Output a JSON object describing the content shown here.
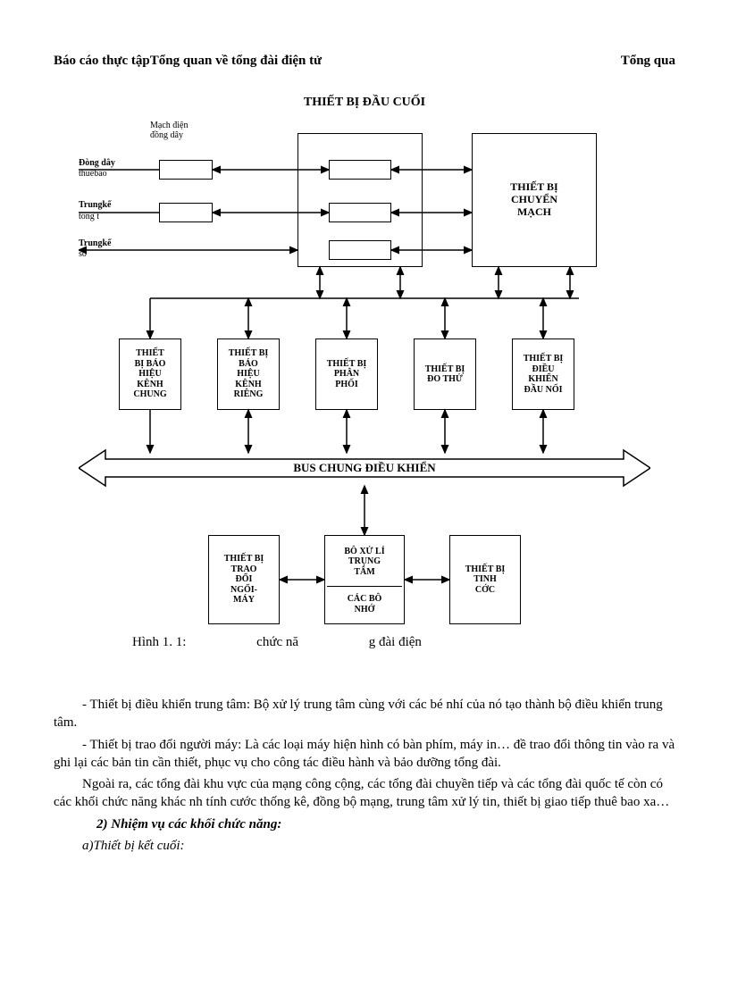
{
  "header": {
    "left": "Báo cáo thực tậpTổng quan về tổng đài điện tử",
    "right": "Tổng qua"
  },
  "diagram": {
    "title": "THIẾT BỊ ĐẦU CUỐI",
    "labels": {
      "circuit": "Mạch điện\nđồng dây",
      "line1a": "Đòng dây",
      "line1b": "thuêbao",
      "line2a": "Trungkế",
      "line2b": "tong t",
      "line3a": "Trungkế",
      "line3b": "só"
    },
    "boxes": {
      "switch": "THIẾT BỊ\nCHUYỂN\nMẠCH",
      "b1": "THIẾT\nBỊ BÁO\nHIỆU\nKÊNH\nCHUNG",
      "b2": "THIẾT BỊ\nBÁO\nHIỆU\nKÊNH\nRIÊNG",
      "b3": "THIẾT BỊ\nPHÂN\nPHỐI",
      "b4": "THIẾT BỊ\nĐO THỬ",
      "b5": "THIẾT BỊ\nĐIỀU\nKHIỂN\nĐẦU NỐI",
      "bus": "BUS CHUNG ĐIỀU KHIỂN",
      "c1": "THIẾT BỊ\nTRAO\nĐỔI\nNGŐI-\nMÁY",
      "c2top": "BÔ XỬ LÍ\nTRỤNG\nTÂM",
      "c2bot": "CÁC BÔ\nNHỚ",
      "c3": "THIẾT BỊ\nTINH\nCỚC"
    }
  },
  "caption": "Hình 1. 1:                     chức nă                     g đài điện",
  "body": {
    "p1": "- Thiết bị điều khiển trung tâm: Bộ xử lý trung tâm cùng với các bé nhí của nó tạo thành bộ điều khiển trung tâm.",
    "p2": "- Thiết bị trao đổi người máy: Là các loại máy hiện hình có bàn phím, máy in… đề trao đổi thông tin vào ra và ghi lại các bản tin cần thiết, phục vụ cho công tác điều hành và bảo dưỡng tổng đài.",
    "p3": "Ngoài ra, các tổng đài khu vực của mạng công cộng, các tổng đài chuyền tiếp và các tổng đài quốc tế còn có các khối chức năng khác nh   tính cước thống kê, đồng bộ mạng, trung tâm xử lý tin, thiết bị giao tiếp thuê bao xa…",
    "s2": "2) Nhiệm vụ các khối chức năng:",
    "s2a": "a)Thiết bị kết cuối:"
  }
}
